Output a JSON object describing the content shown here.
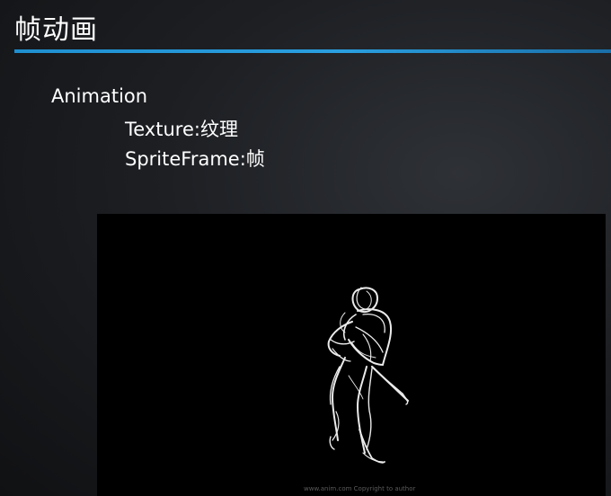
{
  "slide": {
    "title": "帧动画",
    "accent_color": "#2a9fe0",
    "background_color": "#1d1f23"
  },
  "bullets": {
    "level1": "Animation",
    "level2_texture": "Texture:纹理",
    "level2_spriteframe": "SpriteFrame:帧"
  },
  "media": {
    "content": "white sketch figure animation frame",
    "caption": "www.anim.com Copyright to author"
  }
}
